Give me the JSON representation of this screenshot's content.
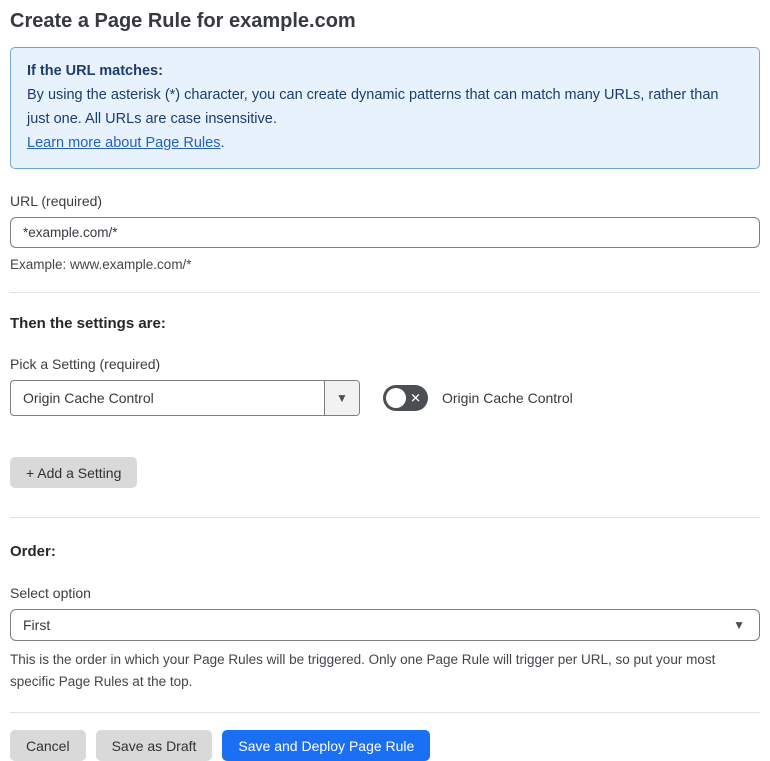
{
  "page": {
    "title": "Create a Page Rule for example.com"
  },
  "info_box": {
    "heading": "If the URL matches:",
    "body": "By using the asterisk (*) character, you can create dynamic patterns that can match many URLs, rather than just one. All URLs are case insensitive.",
    "link_label": "Learn more about Page Rules",
    "link_suffix": "."
  },
  "url_section": {
    "label": "URL (required)",
    "input_value": "*example.com/*",
    "helper": "Example: www.example.com/*"
  },
  "settings_section": {
    "heading": "Then the settings are:",
    "picker_label": "Pick a Setting (required)",
    "selected_setting": "Origin Cache Control",
    "caret_glyph": "▼",
    "toggle_state": "off",
    "toggle_off_glyph": "✕",
    "toggle_label": "Origin Cache Control",
    "add_setting_label": "+ Add a Setting"
  },
  "order_section": {
    "heading": "Order:",
    "select_label": "Select option",
    "selected_option": "First",
    "caret_glyph": "▼",
    "helper": "This is the order in which your Page Rules will be triggered. Only one Page Rule will trigger per URL, so put your most specific Page Rules at the top."
  },
  "actions": {
    "cancel": "Cancel",
    "save_draft": "Save as Draft",
    "save_deploy": "Save and Deploy Page Rule"
  },
  "colors": {
    "accent_blue": "#1a6ff3",
    "info_bg": "#e8f2fc",
    "info_border": "#6fa8dd",
    "info_text": "#1d3c6e",
    "link_blue": "#2161c6",
    "toggle_off_bg": "#4b4e52",
    "button_gray": "#d9d9d9",
    "divider": "#e2e2e2"
  }
}
